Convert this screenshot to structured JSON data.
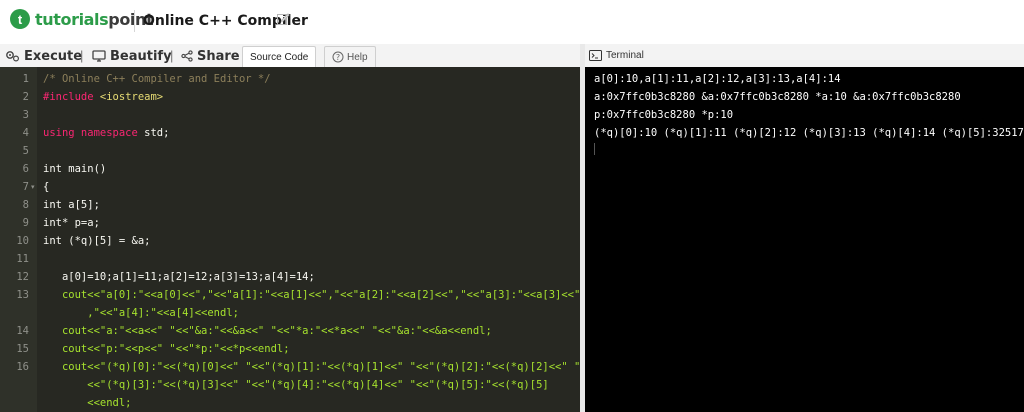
{
  "header": {
    "logo_mark": "t",
    "logo_brand": "tutorials",
    "logo_rest": "point",
    "title": "Online C++ Compiler"
  },
  "toolbar": {
    "execute": "Execute",
    "beautify": "Beautify",
    "share": "Share",
    "source_code_tab": "Source Code",
    "help_tab": "Help"
  },
  "terminal": {
    "title": "Terminal",
    "lines": [
      "a[0]:10,a[1]:11,a[2]:12,a[3]:13,a[4]:14",
      "a:0x7ffc0b3c8280 &a:0x7ffc0b3c8280 *a:10 &a:0x7ffc0b3c8280",
      "p:0x7ffc0b3c8280 *p:10",
      "(*q)[0]:10 (*q)[1]:11 (*q)[2]:12 (*q)[3]:13 (*q)[4]:14 (*q)[5]:32517"
    ]
  },
  "editor": {
    "line_numbers": [
      "1",
      "2",
      "3",
      "4",
      "5",
      "6",
      "7",
      "8",
      "9",
      "10",
      "11",
      "12",
      "13",
      "14",
      "15",
      "16"
    ],
    "lines": {
      "l1": "/* Online C++ Compiler and Editor */",
      "l2a": "#include ",
      "l2b": "<iostream>",
      "l4a": "using namespace",
      "l4b": " std;",
      "l6": "int main()",
      "l7": "{",
      "l8": "int a[5];",
      "l9": "int* p=a;",
      "l10": "int (*q)[5] = &a;",
      "l12": "   a[0]=10;a[1]=11;a[2]=12;a[3]=13;a[4]=14;",
      "l13a": "   cout<<\"a[0]:\"<<a[0]<<\",\"<<\"a[1]:\"<<a[1]<<\",\"<<\"a[2]:\"<<a[2]<<\",\"<<\"a[3]:\"<<a[3]<<\"",
      "l13b": "       ,\"<<\"a[4]:\"<<a[4]<<endl;",
      "l14": "   cout<<\"a:\"<<a<<\" \"<<\"&a:\"<<&a<<\" \"<<\"*a:\"<<*a<<\" \"<<\"&a:\"<<&a<<endl;",
      "l15": "   cout<<\"p:\"<<p<<\" \"<<\"*p:\"<<*p<<endl;",
      "l16a": "   cout<<\"(*q)[0]:\"<<(*q)[0]<<\" \"<<\"(*q)[1]:\"<<(*q)[1]<<\" \"<<\"(*q)[2]:\"<<(*q)[2]<<\" \"",
      "l16b": "       <<\"(*q)[3]:\"<<(*q)[3]<<\" \"<<\"(*q)[4]:\"<<(*q)[4]<<\" \"<<\"(*q)[5]:\"<<(*q)[5]",
      "l16c": "       <<endl;"
    }
  },
  "colors": {
    "brand_green": "#2c9c49",
    "editor_bg": "#272822",
    "terminal_bg": "#000000"
  }
}
